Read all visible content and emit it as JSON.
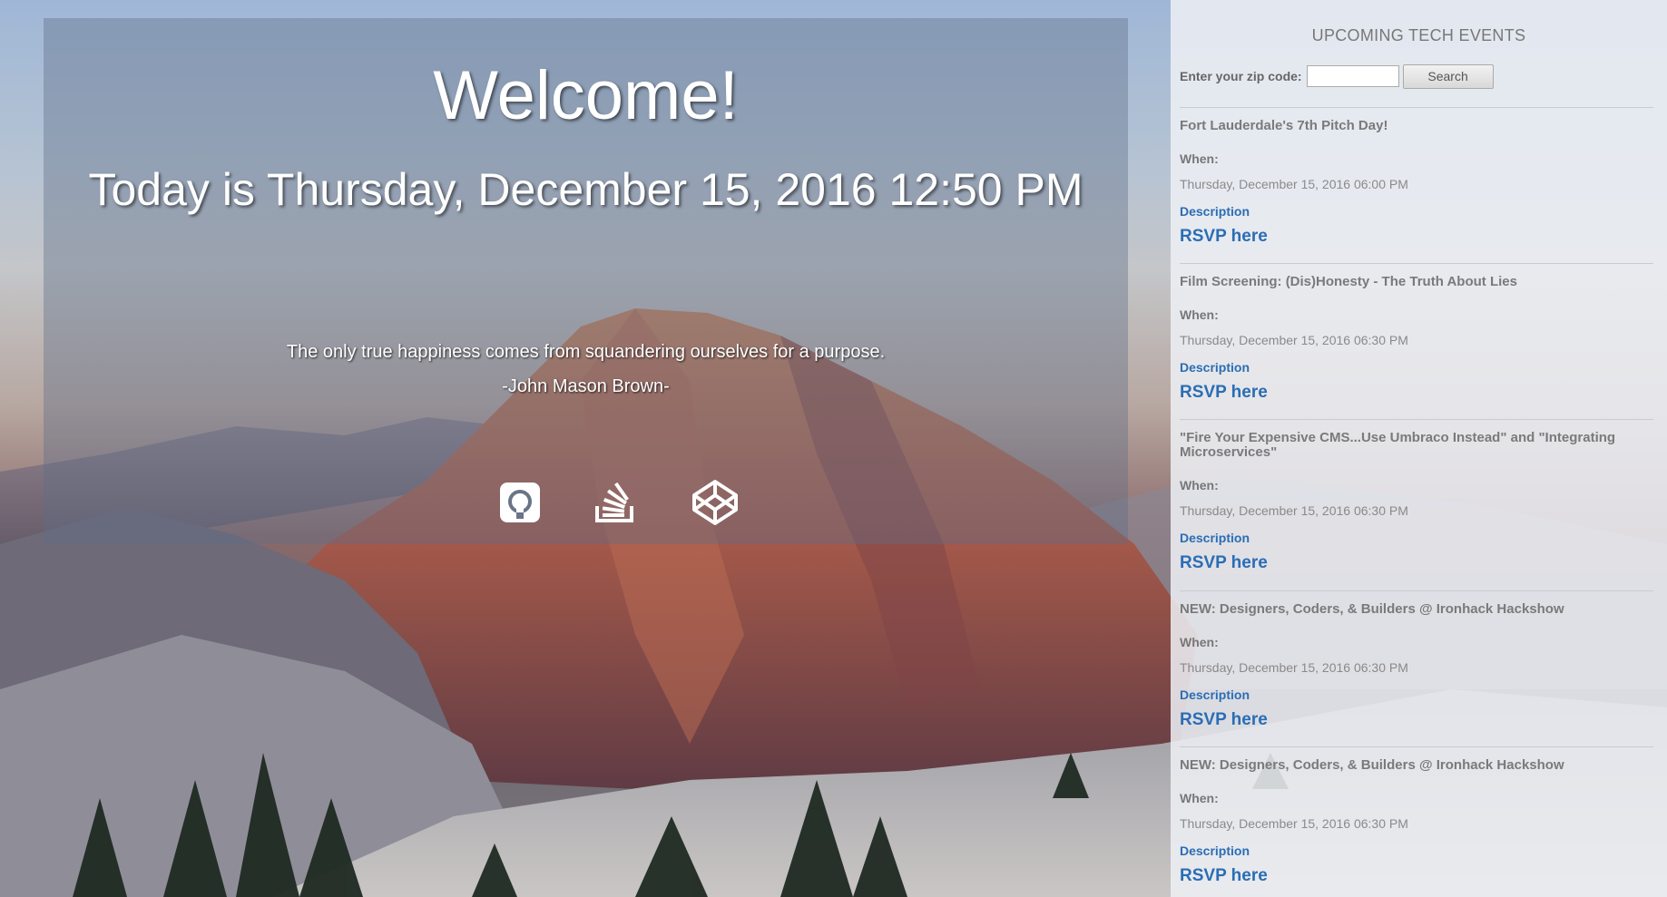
{
  "main": {
    "welcome": "Welcome!",
    "today": "Today is Thursday, December 15, 2016 12:50 PM",
    "quote": "The only true happiness comes from squandering ourselves for a purpose.",
    "author": "-John Mason Brown-"
  },
  "social_links": [
    {
      "icon": "github-icon"
    },
    {
      "icon": "stackoverflow-icon"
    },
    {
      "icon": "codepen-icon"
    }
  ],
  "sidebar": {
    "title": "UPCOMING TECH EVENTS",
    "zip_label": "Enter your zip code:",
    "zip_value": "",
    "search_label": "Search",
    "events": [
      {
        "name": "Fort Lauderdale's 7th Pitch Day!",
        "when_label": "When:",
        "date": "Thursday, December 15, 2016 06:00 PM",
        "description_label": "Description",
        "rsvp_label": "RSVP here"
      },
      {
        "name": "Film Screening: (Dis)Honesty - The Truth About Lies",
        "when_label": "When:",
        "date": "Thursday, December 15, 2016 06:30 PM",
        "description_label": "Description",
        "rsvp_label": "RSVP here"
      },
      {
        "name": "\"Fire Your Expensive CMS...Use Umbraco Instead\" and \"Integrating Microservices\"",
        "when_label": "When:",
        "date": "Thursday, December 15, 2016 06:30 PM",
        "description_label": "Description",
        "rsvp_label": "RSVP here"
      },
      {
        "name": "NEW: Designers, Coders, & Builders @ Ironhack Hackshow",
        "when_label": "When:",
        "date": "Thursday, December 15, 2016 06:30 PM",
        "description_label": "Description",
        "rsvp_label": "RSVP here"
      },
      {
        "name": "NEW: Designers, Coders, & Builders @ Ironhack Hackshow",
        "when_label": "When:",
        "date": "Thursday, December 15, 2016 06:30 PM",
        "description_label": "Description",
        "rsvp_label": "RSVP here"
      }
    ]
  }
}
